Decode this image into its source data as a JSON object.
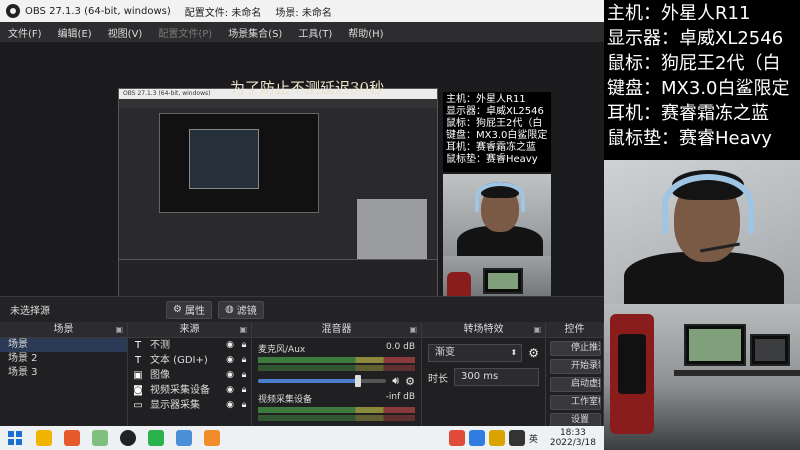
{
  "title_bar": {
    "app": "OBS 27.1.3 (64-bit, windows)",
    "profile": "配置文件: 未命名",
    "scene_collection": "场景: 未命名"
  },
  "menu": [
    "文件(F)",
    "编辑(E)",
    "视图(V)",
    "配置文件(P)",
    "场景集合(S)",
    "工具(T)",
    "帮助(H)"
  ],
  "preview": {
    "overlay_title": "为了防止不测延迟30秒",
    "nested_title": "OBS 27.1.3 (64-bit, windows)",
    "specs_small": [
      "主机：外星人R11",
      "显示器：卓威XL2546",
      "鼠标：狗屁王2代（白",
      "键盘：MX3.0白鲨限定",
      "耳机：赛睿霜冻之蓝",
      "鼠标垫：赛睿Heavy"
    ]
  },
  "strip": {
    "no_source": "未选择源",
    "properties": "属性",
    "filters": "滤镜"
  },
  "scenes": {
    "header": "场景",
    "items": [
      "场景",
      "场景 2",
      "场景 3"
    ]
  },
  "sources": {
    "header": "来源",
    "items": [
      {
        "icon": "T",
        "label": "不测"
      },
      {
        "icon": "T",
        "label": "文本 (GDI+)"
      },
      {
        "icon": "▣",
        "label": "图像"
      },
      {
        "icon": "◙",
        "label": "视频采集设备"
      },
      {
        "icon": "▭",
        "label": "显示器采集"
      }
    ]
  },
  "mixer": {
    "header": "混音器",
    "channels": [
      {
        "name": "麦克风/Aux",
        "db": "0.0 dB",
        "volume_fraction": 0.78
      },
      {
        "name": "视频采集设备",
        "db": "-inf dB",
        "volume_fraction": 0.78
      }
    ]
  },
  "transitions": {
    "header": "转场特效",
    "selected": "渐变",
    "duration_label": "时长",
    "duration_value": "300 ms"
  },
  "controls": {
    "header": "控件",
    "buttons": [
      "停止推流",
      "开始录制",
      "启动虚拟摄像机",
      "工作室模式",
      "设置"
    ]
  },
  "taskbar": {
    "tray_lang": "英",
    "time": "18:33",
    "date": "2022/3/18"
  },
  "overlay_specs": [
    "主机：外星人R11",
    "显示器：卓威XL2546",
    "鼠标：狗屁王2代（白",
    "键盘：MX3.0白鲨限定",
    "耳机：赛睿霜冻之蓝",
    "鼠标垫：赛睿Heavy"
  ],
  "colors": {
    "obs_dark": "#1b1b1d",
    "panel": "#202022",
    "selection": "#2b3a55",
    "meter_green": "#3d7a3d",
    "fader_blue": "#4a7fd0",
    "headset_blue": "#9fc4e4",
    "chair_red": "#8a1c1c"
  }
}
